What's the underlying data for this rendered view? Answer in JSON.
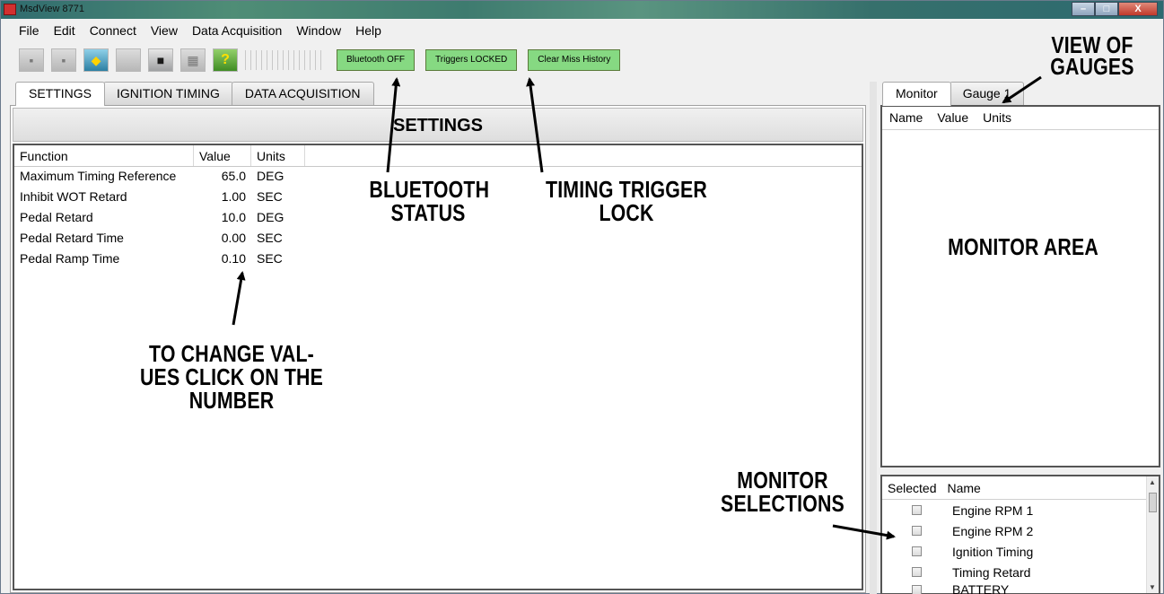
{
  "window": {
    "title": "MsdView 8771",
    "controls": [
      "–",
      "□",
      "X"
    ]
  },
  "menu": [
    "File",
    "Edit",
    "Connect",
    "View",
    "Data Acquisition",
    "Window",
    "Help"
  ],
  "toolbar": {
    "icons": [
      "open-icon",
      "save-icon",
      "connect-icon",
      "blank-icon",
      "device-icon",
      "grid-icon",
      "help-icon"
    ],
    "help_glyph": "?",
    "bluetooth_label": "Bluetooth OFF",
    "triggers_label": "Triggers LOCKED",
    "clear_label": "Clear Miss History",
    "status_color": "#86d982"
  },
  "left_tabs": [
    "SETTINGS",
    "IGNITION TIMING",
    "DATA ACQUISITION"
  ],
  "settings": {
    "header": "SETTINGS",
    "columns": {
      "function": "Function",
      "value": "Value",
      "units": "Units"
    },
    "rows": [
      {
        "function": "Maximum Timing Reference",
        "value": "65.0",
        "units": "DEG"
      },
      {
        "function": "Inhibit WOT Retard",
        "value": "1.00",
        "units": "SEC"
      },
      {
        "function": "Pedal Retard",
        "value": "10.0",
        "units": "DEG"
      },
      {
        "function": "Pedal Retard Time",
        "value": "0.00",
        "units": "SEC"
      },
      {
        "function": "Pedal Ramp Time",
        "value": "0.10",
        "units": "SEC"
      }
    ]
  },
  "right_tabs": [
    "Monitor",
    "Gauge 1"
  ],
  "monitor": {
    "columns": {
      "name": "Name",
      "value": "Value",
      "units": "Units"
    }
  },
  "selections": {
    "columns": {
      "selected": "Selected",
      "name": "Name"
    },
    "items": [
      "Engine RPM 1",
      "Engine RPM 2",
      "Ignition Timing",
      "Timing Retard",
      "BATTERY"
    ]
  },
  "callouts": {
    "view_of_gauges": [
      "VIEW OF",
      "GAUGES"
    ],
    "bluetooth_status": [
      "BLUETOOTH",
      "STATUS"
    ],
    "timing_trigger_lock": [
      "TIMING TRIGGER",
      "LOCK"
    ],
    "monitor_area": "MONITOR AREA",
    "change_values": [
      "TO CHANGE VAL-",
      "UES CLICK ON THE",
      "NUMBER"
    ],
    "monitor_selections": [
      "MONITOR",
      "SELECTIONS"
    ]
  }
}
